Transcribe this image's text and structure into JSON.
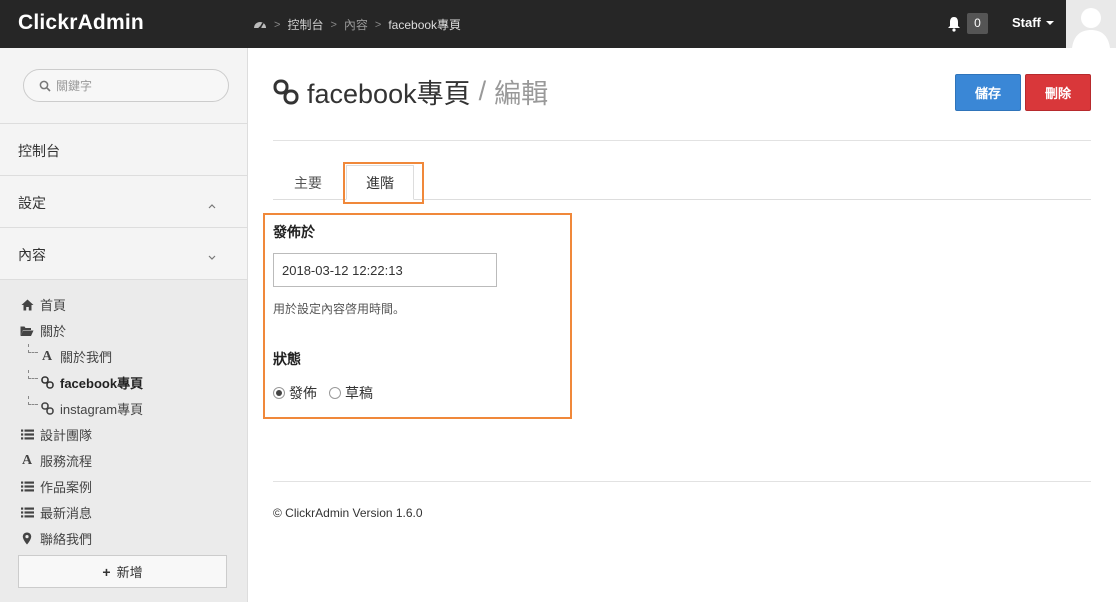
{
  "app": {
    "brand": "ClickrAdmin"
  },
  "breadcrumb": {
    "home_icon": "dashboard-icon",
    "items": [
      "控制台",
      "內容",
      "facebook專頁"
    ]
  },
  "header": {
    "notification_icon": "bell-icon",
    "notification_count": "0",
    "user_label": "Staff"
  },
  "sidebar": {
    "search_placeholder": "關鍵字",
    "sections": [
      {
        "label": "控制台"
      },
      {
        "label": "設定"
      },
      {
        "label": "內容"
      }
    ],
    "tree": [
      {
        "label": "首頁",
        "icon": "home-icon"
      },
      {
        "label": "關於",
        "icon": "folder-open-icon"
      },
      {
        "label": "關於我們",
        "icon": "font-icon"
      },
      {
        "label": "facebook專頁",
        "icon": "link-icon",
        "active": true
      },
      {
        "label": "instagram專頁",
        "icon": "link-icon"
      },
      {
        "label": "設計團隊",
        "icon": "list-icon"
      },
      {
        "label": "服務流程",
        "icon": "font-icon"
      },
      {
        "label": "作品案例",
        "icon": "list-icon"
      },
      {
        "label": "最新消息",
        "icon": "list-icon"
      },
      {
        "label": "聯絡我們",
        "icon": "map-marker-icon"
      }
    ],
    "add_label": "新增"
  },
  "main": {
    "title": "facebook專頁",
    "title_sep": "/",
    "subtitle": "編輯",
    "save_label": "儲存",
    "delete_label": "刪除",
    "tabs": [
      {
        "label": "主要"
      },
      {
        "label": "進階",
        "active": true
      }
    ],
    "form": {
      "publish_label": "發佈於",
      "publish_value": "2018-03-12 12:22:13",
      "publish_help": "用於設定內容啓用時間。",
      "status_label": "狀態",
      "status_options": [
        {
          "label": "發佈",
          "checked": true
        },
        {
          "label": "草稿",
          "checked": false
        }
      ]
    },
    "footer": "© ClickrAdmin Version 1.6.0"
  },
  "colors": {
    "topbar": "#262626",
    "save": "#3a87d6",
    "delete": "#d9373a",
    "highlight": "#f0883a"
  }
}
